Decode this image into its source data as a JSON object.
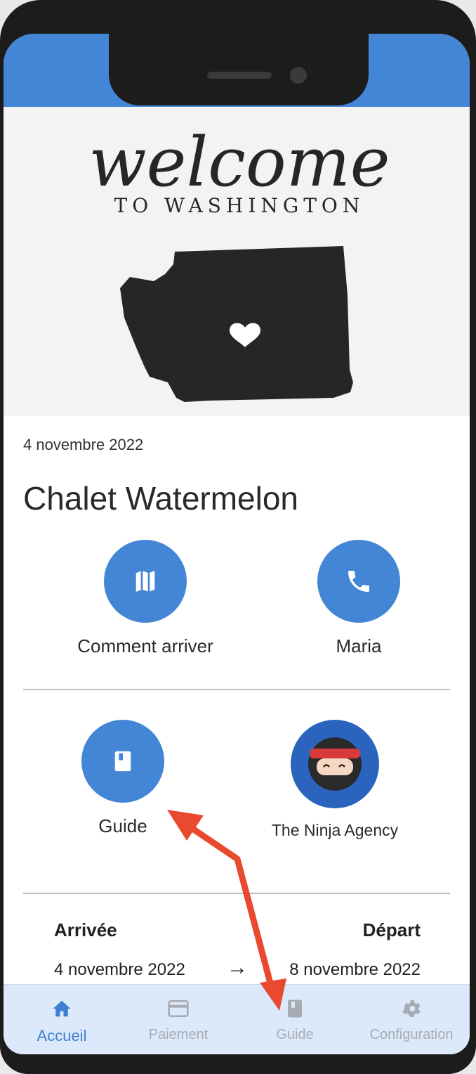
{
  "appbar": {
    "title": "Chalet Watermelon"
  },
  "hero": {
    "script_text": "welcome",
    "sub_text": "TO WASHINGTON"
  },
  "listing": {
    "date": "4 novembre 2022",
    "title": "Chalet Watermelon"
  },
  "actions": [
    {
      "label": "Comment arriver",
      "icon": "map-icon"
    },
    {
      "label": "Maria",
      "icon": "phone-icon"
    },
    {
      "label": "Guide",
      "icon": "book-icon"
    },
    {
      "label": "The Ninja Agency",
      "icon": "ninja-avatar"
    }
  ],
  "stay": {
    "arrival_label": "Arrivée",
    "arrival_date": "4 novembre 2022",
    "departure_label": "Départ",
    "departure_date": "8 novembre 2022",
    "arrow": "→"
  },
  "nav": [
    {
      "label": "Accueil",
      "icon": "home-icon",
      "active": true
    },
    {
      "label": "Paiement",
      "icon": "card-icon",
      "active": false
    },
    {
      "label": "Guide",
      "icon": "book-icon",
      "active": false
    },
    {
      "label": "Configuration",
      "icon": "gear-icon",
      "active": false
    }
  ],
  "colors": {
    "accent": "#4386d6",
    "nav_bg": "#dbe9fb",
    "annotation": "#e8492f"
  }
}
